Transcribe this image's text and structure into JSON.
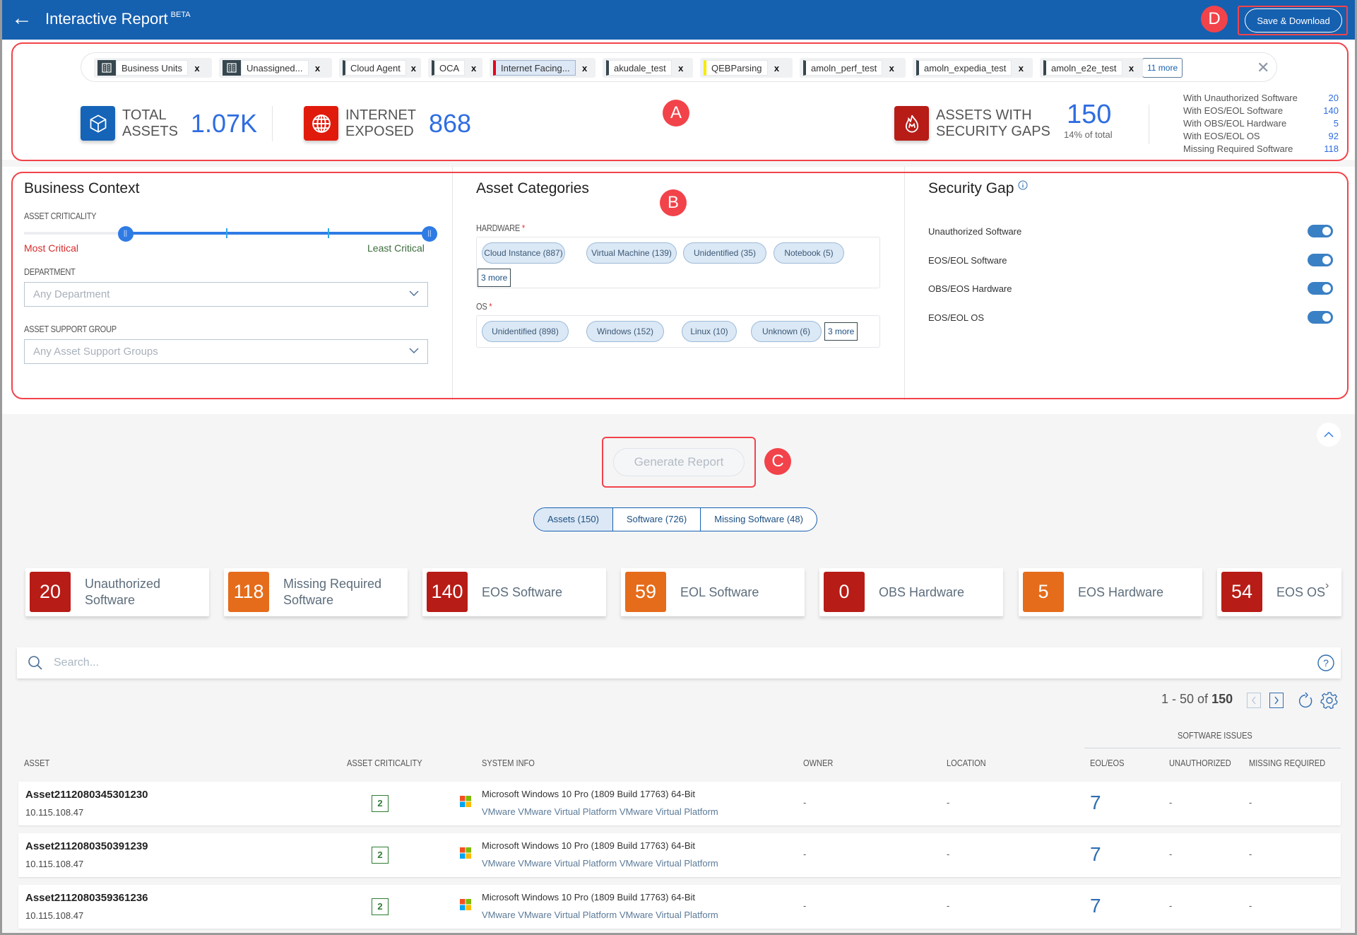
{
  "header": {
    "title": "Interactive Report",
    "badge": "BETA",
    "back_icon": "arrow-left-icon",
    "save_download_label": "Save & Download"
  },
  "annotations": [
    "A",
    "B",
    "C",
    "D"
  ],
  "filter_chips": [
    {
      "label": "Business Units",
      "icon": "building-icon"
    },
    {
      "label": "Unassigned...",
      "icon": "building-icon"
    },
    {
      "label": "Cloud Agent"
    },
    {
      "label": "OCA"
    },
    {
      "label": "Internet Facing...",
      "highlighted": true,
      "accent": "#e8001c"
    },
    {
      "label": "akudale_test"
    },
    {
      "label": "QEBParsing",
      "accent": "#f5ea00"
    },
    {
      "label": "amoln_perf_test"
    },
    {
      "label": "amoln_expedia_test"
    },
    {
      "label": "amoln_e2e_test"
    }
  ],
  "filter_more": "11 more",
  "summary": {
    "total_assets": {
      "label_line1": "TOTAL",
      "label_line2": "ASSETS",
      "value": "1.07K"
    },
    "internet_exposed": {
      "label_line1": "INTERNET",
      "label_line2": "EXPOSED",
      "value": "868"
    },
    "security_gaps": {
      "label_line1": "ASSETS WITH",
      "label_line2": "SECURITY GAPS",
      "value": "150",
      "sub": "14% of total"
    },
    "breakdown": [
      {
        "label": "With Unauthorized Software",
        "value": "20"
      },
      {
        "label": "With EOS/EOL Software",
        "value": "140"
      },
      {
        "label": "With OBS/EOL Hardware",
        "value": "5"
      },
      {
        "label": "With EOS/EOL OS",
        "value": "92"
      },
      {
        "label": "Missing Required Software",
        "value": "118"
      }
    ]
  },
  "business_context": {
    "title": "Business Context",
    "criticality_label": "ASSET CRITICALITY",
    "criticality_range": {
      "min_label": "Most Critical",
      "max_label": "Least Critical",
      "low": 2,
      "high": 5,
      "scale_min": 1,
      "scale_max": 5
    },
    "department_label": "DEPARTMENT",
    "department_placeholder": "Any Department",
    "support_group_label": "ASSET SUPPORT GROUP",
    "support_group_placeholder": "Any Asset Support Groups"
  },
  "asset_categories": {
    "title": "Asset Categories",
    "hardware_label": "HARDWARE",
    "hardware": [
      "Cloud Instance (887)",
      "Virtual Machine (139)",
      "Unidentified (35)",
      "Notebook (5)"
    ],
    "hardware_more": "3 more",
    "os_label": "OS",
    "os": [
      "Unidentified (898)",
      "Windows (152)",
      "Linux (10)",
      "Unknown (6)"
    ],
    "os_more": "3 more",
    "required_mark": "*"
  },
  "security_gap": {
    "title": "Security Gap",
    "toggles": [
      {
        "label": "Unauthorized Software",
        "on": true
      },
      {
        "label": "EOS/EOL Software",
        "on": true
      },
      {
        "label": "OBS/EOS Hardware",
        "on": true
      },
      {
        "label": "EOS/EOL OS",
        "on": true
      }
    ]
  },
  "generate_report_label": "Generate Report",
  "view_tabs": [
    {
      "label": "Assets (150)",
      "active": true
    },
    {
      "label": "Software (726)",
      "active": false
    },
    {
      "label": "Missing Software (48)",
      "active": false
    }
  ],
  "kpi_cards": [
    {
      "value": "20",
      "label": "Unauthorized Software",
      "color": "#b71c17"
    },
    {
      "value": "118",
      "label": "Missing Required Software",
      "color": "#e56c1b"
    },
    {
      "value": "140",
      "label": "EOS Software",
      "color": "#b71c17"
    },
    {
      "value": "59",
      "label": "EOL Software",
      "color": "#e56c1b"
    },
    {
      "value": "0",
      "label": "OBS Hardware",
      "color": "#b71c17"
    },
    {
      "value": "5",
      "label": "EOS Hardware",
      "color": "#e56c1b"
    },
    {
      "value": "54",
      "label": "EOS OS",
      "color": "#b71c17"
    }
  ],
  "search": {
    "placeholder": "Search..."
  },
  "pagination": {
    "range": "1 - 50 of",
    "total": "150"
  },
  "table": {
    "group_header": "SOFTWARE ISSUES",
    "columns": [
      "ASSET",
      "ASSET CRITICALITY",
      "SYSTEM INFO",
      "OWNER",
      "LOCATION",
      "EOL/EOS",
      "UNAUTHORIZED",
      "MISSING REQUIRED"
    ],
    "rows": [
      {
        "asset": "Asset2112080345301230",
        "ip": "10.115.108.47",
        "criticality": "2",
        "os": "Microsoft Windows 10 Pro (1809 Build 17763) 64-Bit",
        "hardware": "VMware VMware Virtual Platform VMware Virtual Platform",
        "owner": "-",
        "location": "-",
        "eol_eos": "7",
        "unauthorized": "-",
        "missing_required": "-"
      },
      {
        "asset": "Asset2112080350391239",
        "ip": "10.115.108.47",
        "criticality": "2",
        "os": "Microsoft Windows 10 Pro (1809 Build 17763) 64-Bit",
        "hardware": "VMware VMware Virtual Platform VMware Virtual Platform",
        "owner": "-",
        "location": "-",
        "eol_eos": "7",
        "unauthorized": "-",
        "missing_required": "-"
      },
      {
        "asset": "Asset2112080359361236",
        "ip": "10.115.108.47",
        "criticality": "2",
        "os": "Microsoft Windows 10 Pro (1809 Build 17763) 64-Bit",
        "hardware": "VMware VMware Virtual Platform VMware Virtual Platform",
        "owner": "-",
        "location": "-",
        "eol_eos": "7",
        "unauthorized": "-",
        "missing_required": "-"
      }
    ]
  },
  "colors": {
    "brand": "#1660b0",
    "accent_blue": "#2f6de1",
    "annotation_red": "#f2434a",
    "critical_red": "#b71c17",
    "warning_orange": "#e56c1b"
  }
}
